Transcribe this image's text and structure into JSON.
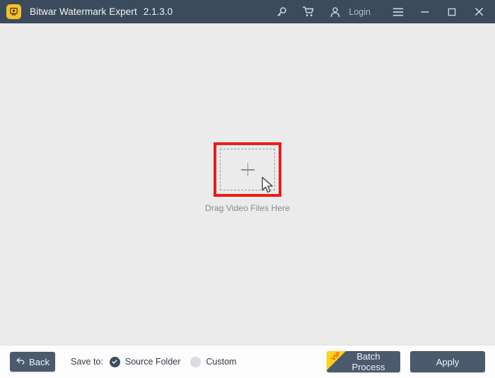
{
  "window": {
    "title": "Bitwar Watermark Expert",
    "version": "2.1.3.0",
    "logo_icon": "app-logo-icon",
    "titlebar_color": "#3c4b5c",
    "body_color": "#ebebeb"
  },
  "titlebar": {
    "key_icon": "key-icon",
    "cart_icon": "shopping-cart-icon",
    "account_icon": "user-account-icon",
    "login_label": "Login",
    "menu_icon": "hamburger-menu-icon",
    "minimize_icon": "minimize-icon",
    "maximize_icon": "maximize-icon",
    "close_icon": "close-icon"
  },
  "main": {
    "dropzone": {
      "plus_icon": "plus-icon",
      "caption": "Drag Video Files Here",
      "highlight_color": "#ec1c1c",
      "cursor_icon": "mouse-cursor-icon"
    }
  },
  "bottombar": {
    "back_label": "Back",
    "back_icon": "back-arrow-icon",
    "save_to_label": "Save to:",
    "radios": [
      {
        "label": "Source Folder",
        "checked": true
      },
      {
        "label": "Custom",
        "checked": false
      }
    ],
    "batch_label": "Batch Process",
    "vip_badge": "VIP",
    "vip_color": "#fcd21c",
    "apply_label": "Apply",
    "button_color": "#4b5a6c"
  }
}
